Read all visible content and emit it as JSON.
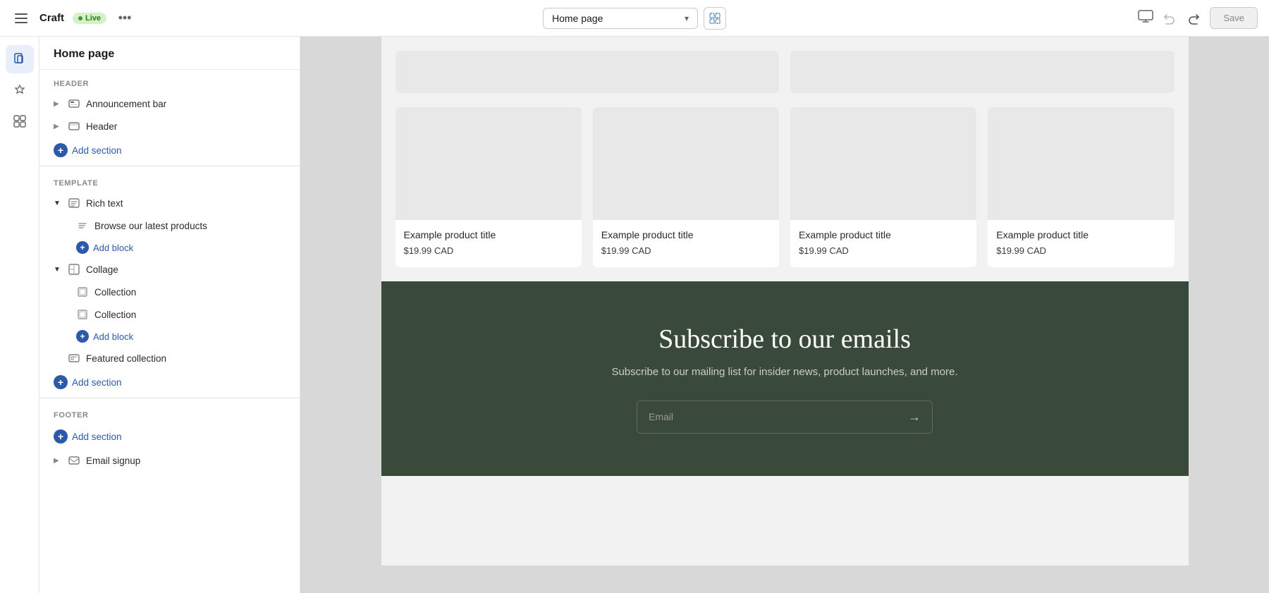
{
  "topbar": {
    "app_name": "Craft",
    "live_label": "Live",
    "more_label": "•••",
    "page_selector_value": "Home page",
    "save_label": "Save"
  },
  "left_panel": {
    "title": "Home page",
    "sections": {
      "header_label": "HEADER",
      "announcement_bar": "Announcement bar",
      "header": "Header",
      "add_section_header": "Add section",
      "template_label": "TEMPLATE",
      "rich_text": "Rich text",
      "browse_block": "Browse our latest products",
      "add_block_1": "Add block",
      "collage": "Collage",
      "collection_1": "Collection",
      "collection_2": "Collection",
      "add_block_2": "Add block",
      "featured_collection": "Featured collection",
      "add_section_template": "Add section",
      "footer_label": "FOOTER",
      "add_section_footer": "Add section",
      "email_signup": "Email signup"
    }
  },
  "canvas": {
    "product_title": "Example product title",
    "product_price": "$19.99 CAD",
    "subscribe_title": "Subscribe to our emails",
    "subscribe_subtitle": "Subscribe to our mailing list for insider news, product launches, and more.",
    "email_placeholder": "Email"
  }
}
